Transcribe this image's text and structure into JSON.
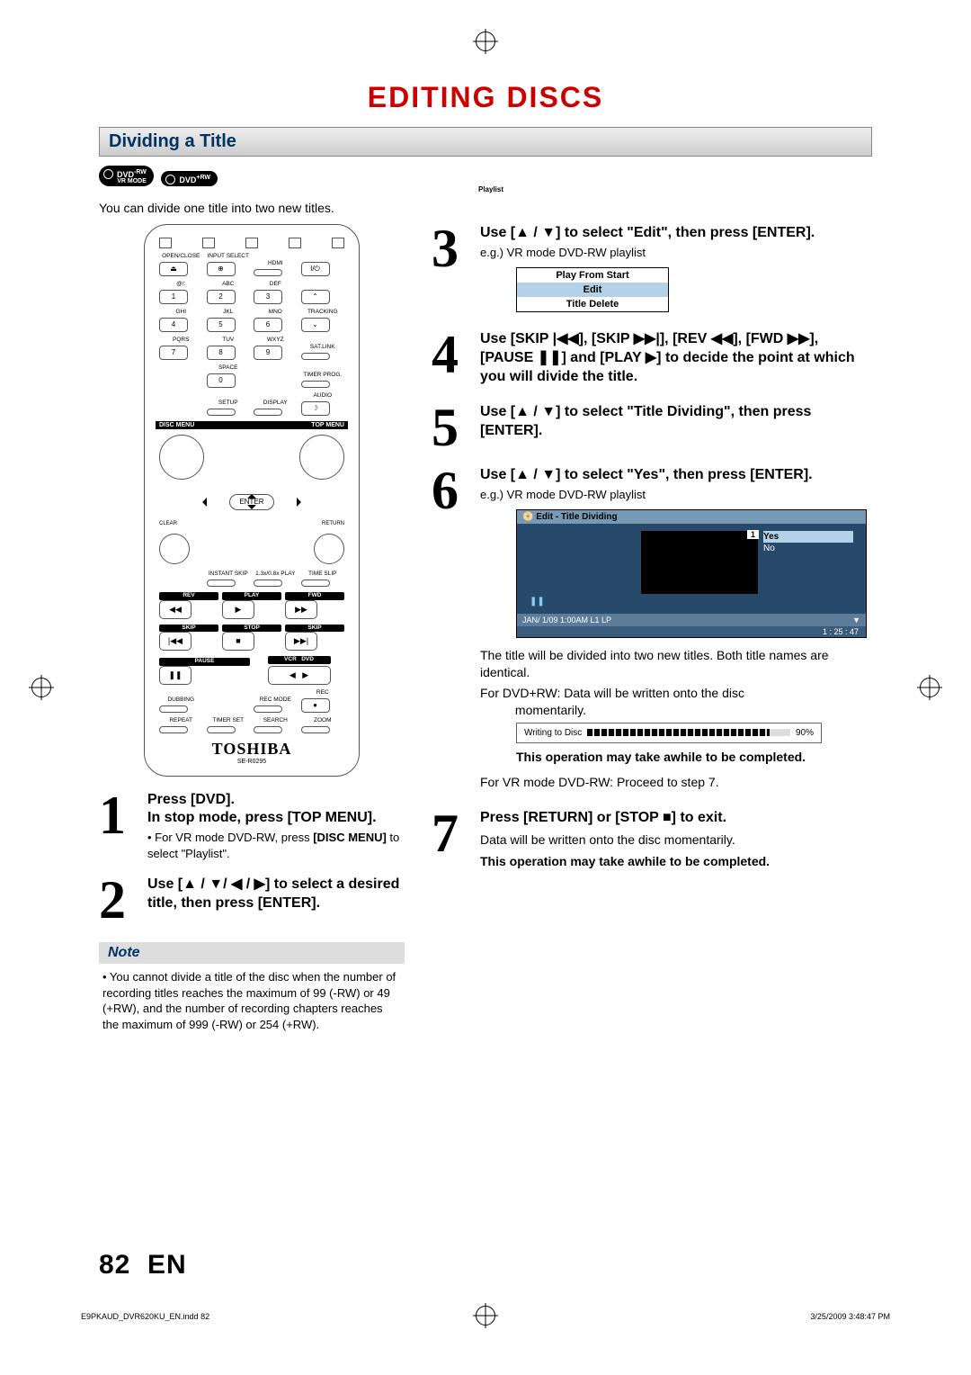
{
  "page_title": "EDITING DISCS",
  "section_title": "Dividing a Title",
  "badges": {
    "rw": "DVD -RW",
    "rw_mode": "VR MODE",
    "plusrw": "DVD +RW",
    "playlist": "Playlist"
  },
  "intro": "You can divide one title into two new titles.",
  "remote": {
    "top_labels": [
      "OPEN/CLOSE",
      "INPUT SELECT",
      "HDMI",
      ""
    ],
    "row2_labels": [
      "@/:",
      "ABC",
      "DEF",
      ""
    ],
    "row2_vals": [
      "1",
      "2",
      "3",
      ""
    ],
    "row3_labels": [
      "GHI",
      "JKL",
      "MNO",
      "TRACKING"
    ],
    "row3_vals": [
      "4",
      "5",
      "6",
      ""
    ],
    "row4_labels": [
      "PQRS",
      "TUV",
      "WXYZ",
      "SAT.LINK"
    ],
    "row4_vals": [
      "7",
      "8",
      "9",
      ""
    ],
    "row5_labels": [
      "",
      "SPACE",
      "",
      "TIMER PROG."
    ],
    "row5_vals": [
      "",
      "0",
      "",
      ""
    ],
    "row6_labels": [
      "",
      "SETUP",
      "DISPLAY",
      "AUDIO"
    ],
    "disc_menu": "DISC MENU",
    "top_menu": "TOP MENU",
    "clear": "CLEAR",
    "return": "RETURN",
    "enter": "ENTER",
    "row_instant": [
      "",
      "INSTANT SKIP",
      "1.3x/0.8x PLAY",
      "TIME SLIP"
    ],
    "transport1": [
      "REV",
      "PLAY",
      "FWD"
    ],
    "transport2": [
      "SKIP",
      "STOP",
      "SKIP"
    ],
    "transport3": [
      "PAUSE",
      "VCR",
      "DVD"
    ],
    "row_dub": [
      "DUBBING",
      "",
      "REC MODE",
      "REC"
    ],
    "row_last": [
      "REPEAT",
      "TIMER SET",
      "SEARCH",
      "ZOOM"
    ],
    "brand": "TOSHIBA",
    "model": "SE-R0295"
  },
  "steps": {
    "1": {
      "bold": "Press [DVD].\nIn stop mode, press [TOP MENU].",
      "sub_prefix": "• For VR mode DVD-RW, press ",
      "sub_bold": "[DISC MENU]",
      "sub_suffix": " to select \"Playlist\"."
    },
    "2": {
      "bold": "Use [▲ / ▼/ ◀ / ▶] to select a desired title, then press [ENTER]."
    },
    "3": {
      "bold": "Use [▲ / ▼] to select \"Edit\", then press [ENTER].",
      "eg": "e.g.) VR mode DVD-RW playlist",
      "menu": [
        "Play From Start",
        "Edit",
        "Title Delete"
      ]
    },
    "4": {
      "bold": "Use [SKIP |◀◀], [SKIP ▶▶|], [REV ◀◀], [FWD ▶▶], [PAUSE ❚❚] and [PLAY ▶] to decide the point at which you will divide the title."
    },
    "5": {
      "bold": "Use [▲ / ▼] to select \"Title Dividing\", then press [ENTER]."
    },
    "6": {
      "bold": "Use [▲ / ▼] to select \"Yes\", then press [ENTER].",
      "eg": "e.g.) VR mode DVD-RW playlist",
      "ss": {
        "title": "Edit - Title Dividing",
        "chip": "1",
        "opt_yes": "Yes",
        "opt_no": "No",
        "pause": "❚❚",
        "foot_left": "JAN/ 1/09 1:00AM L1   LP",
        "time": "1 : 25 : 47"
      },
      "p1": "The title will be divided into two new titles. Both title names are identical.",
      "p2_pre": "For DVD+RW: Data will be written onto the disc ",
      "p2_suf": "momentarily.",
      "progress_label": "Writing to Disc",
      "progress_pct": "90%",
      "warn": "This operation may take awhile to be completed.",
      "p3": "For VR mode DVD-RW: Proceed to step 7."
    },
    "7": {
      "bold": "Press [RETURN] or [STOP ■] to exit.",
      "p1": "Data will be written onto the disc momentarily.",
      "warn": "This operation may take awhile to be completed."
    }
  },
  "note": {
    "title": "Note",
    "body": "• You cannot divide a title of the disc when the number of recording titles reaches the maximum of 99 (-RW) or 49 (+RW), and the number of recording chapters reaches the maximum of 999 (-RW) or 254 (+RW)."
  },
  "footer": {
    "page": "82",
    "lang": "EN",
    "file": "E9PKAUD_DVR620KU_EN.indd   82",
    "dt": "3/25/2009   3:48:47 PM"
  }
}
